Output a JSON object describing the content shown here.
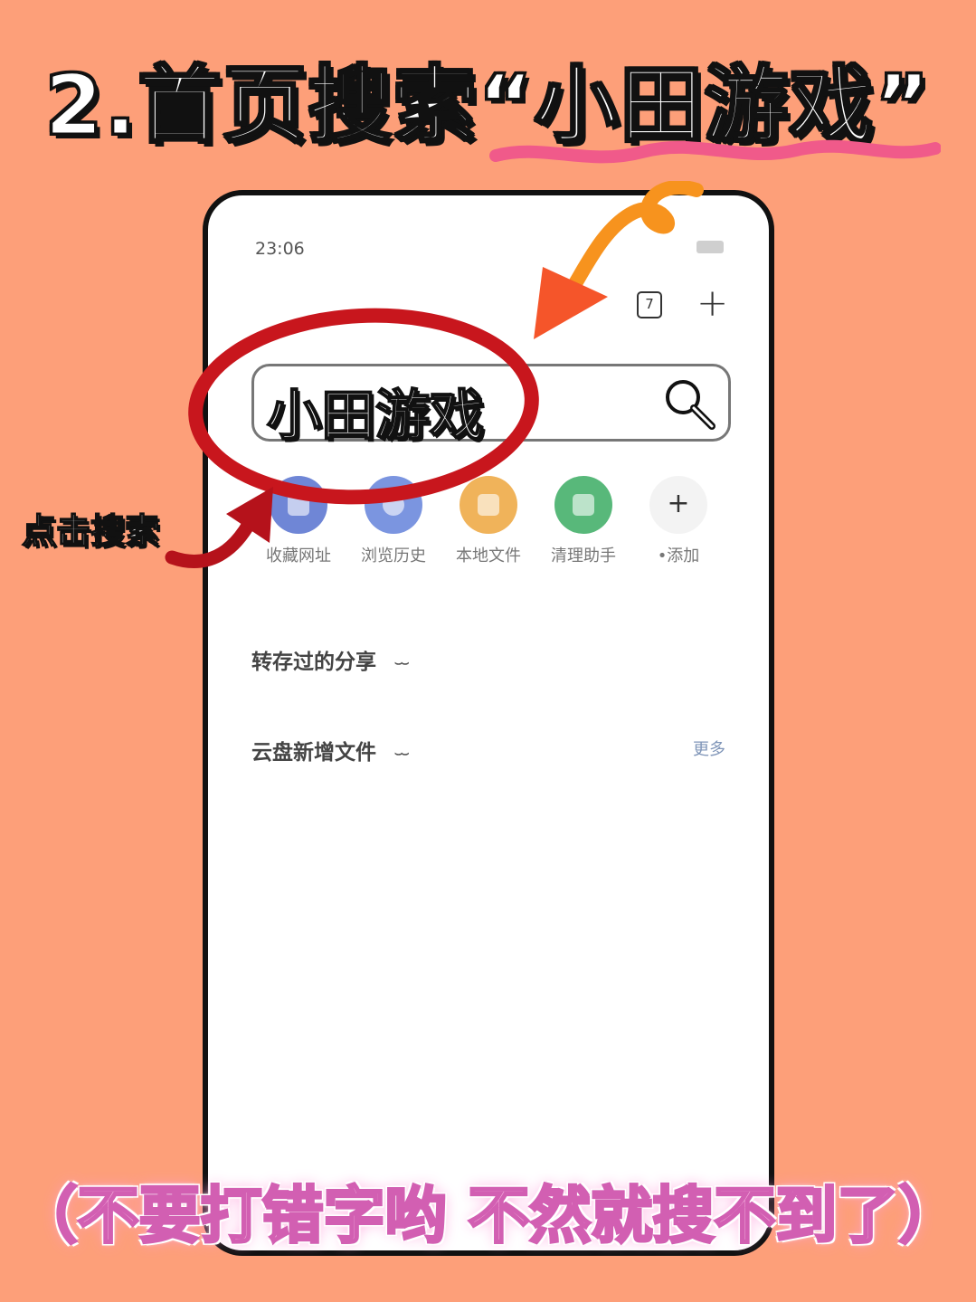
{
  "headline": "2.首页搜索“小田游戏”",
  "phone": {
    "status_time": "23:06",
    "tabs_count": "7",
    "plus_symbol": "+",
    "search_text": "小田游戏",
    "shortcuts": [
      {
        "label": "收藏网址",
        "color": "#6f86d6"
      },
      {
        "label": "浏览历史",
        "color": "#7b95e0"
      },
      {
        "label": "本地文件",
        "color": "#f0b35a"
      },
      {
        "label": "清理助手",
        "color": "#58b87a"
      },
      {
        "label": "•添加",
        "symbol": "+"
      }
    ],
    "sections": [
      {
        "title": "转存过的分享"
      },
      {
        "title": "云盘新增文件",
        "more": "更多"
      }
    ]
  },
  "annotations": {
    "click_label": "点击搜索",
    "banner": "（不要打错字哟 不然就搜不到了）"
  },
  "colors": {
    "background": "#FD9F79",
    "ellipse": "#c8161d",
    "arrow_orange": "#f7931e",
    "arrow_red": "#b5121b",
    "banner_fill": "#ffc7ea"
  }
}
